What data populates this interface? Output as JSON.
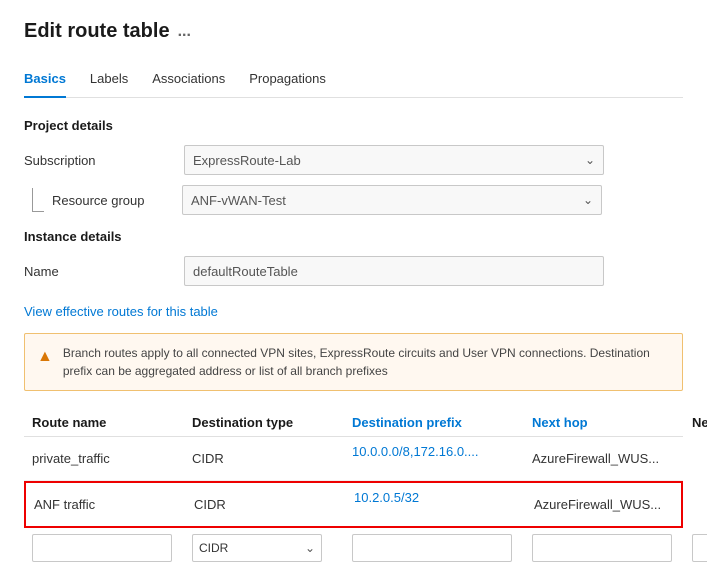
{
  "page": {
    "title": "Edit route table",
    "ellipsis": "..."
  },
  "tabs": [
    {
      "id": "basics",
      "label": "Basics",
      "active": true
    },
    {
      "id": "labels",
      "label": "Labels",
      "active": false
    },
    {
      "id": "associations",
      "label": "Associations",
      "active": false
    },
    {
      "id": "propagations",
      "label": "Propagations",
      "active": false
    }
  ],
  "sections": {
    "project": {
      "title": "Project details",
      "subscription": {
        "label": "Subscription",
        "value": "ExpressRoute-Lab"
      },
      "resource_group": {
        "label": "Resource group",
        "value": "ANF-vWAN-Test"
      }
    },
    "instance": {
      "title": "Instance details",
      "name": {
        "label": "Name",
        "value": "defaultRouteTable"
      }
    }
  },
  "link": {
    "view_routes": "View effective routes for this table"
  },
  "warning": {
    "text": "Branch routes apply to all connected VPN sites, ExpressRoute circuits and User VPN connections. Destination prefix can be aggregated address or list of all branch prefixes"
  },
  "table": {
    "headers": [
      {
        "id": "route-name",
        "label": "Route name"
      },
      {
        "id": "dest-type",
        "label": "Destination type"
      },
      {
        "id": "dest-prefix",
        "label": "Destination prefix"
      },
      {
        "id": "next-hop",
        "label": "Next hop"
      },
      {
        "id": "next-hop-ip",
        "label": "Next Hop IP"
      }
    ],
    "rows": [
      {
        "route_name": "private_traffic",
        "dest_type": "CIDR",
        "dest_prefix": "10.0.0.0/8,172.16.0....",
        "next_hop": "AzureFirewall_WUS...",
        "next_hop_ip": "",
        "selected": false
      },
      {
        "route_name": "ANF traffic",
        "dest_type": "CIDR",
        "dest_prefix": "10.2.0.5/32",
        "next_hop": "AzureFirewall_WUS...",
        "next_hop_ip": "",
        "selected": true
      }
    ],
    "add_row": {
      "input_placeholder": "",
      "dropdown_value": "CIDR",
      "input2_placeholder": "",
      "dropdown2_value": ""
    }
  }
}
